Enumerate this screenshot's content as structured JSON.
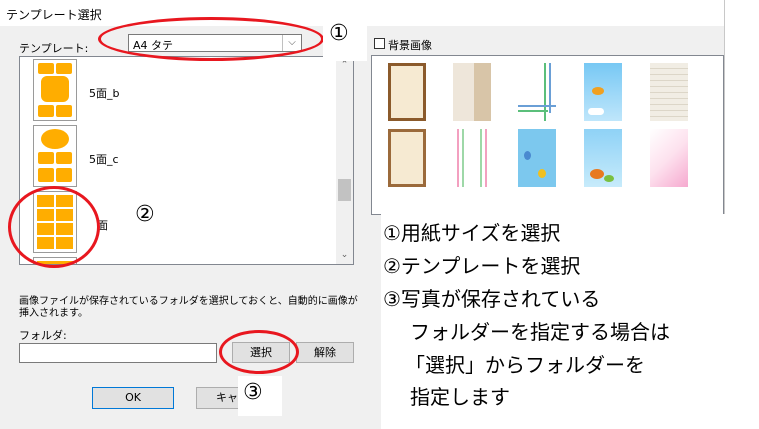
{
  "window": {
    "title": "テンプレート選択"
  },
  "template_label": "テンプレート:",
  "paper_select": {
    "value": "A4 タテ"
  },
  "templates": [
    {
      "name": "5面_b"
    },
    {
      "name": "5面_c"
    },
    {
      "name": "面"
    }
  ],
  "help_text": "画像ファイルが保存されているフォルダを選択しておくと、自動的に画像が挿入されます。",
  "folder_label": "フォルダ:",
  "folder_value": "",
  "buttons": {
    "select": "選択",
    "clear": "解除",
    "ok": "OK",
    "cancel": "キャン"
  },
  "bg_image_label": "背景画像",
  "annotations": {
    "num1": "①",
    "num2": "②",
    "num3": "③",
    "lines": [
      "①用紙サイズを選択",
      "②テンプレートを選択",
      "③写真が保存されている",
      "フォルダーを指定する場合は",
      "「選択」からフォルダーを",
      "指定します"
    ]
  },
  "colors": {
    "template_cell": "#ffad00",
    "annotation_red": "#e8171f"
  }
}
